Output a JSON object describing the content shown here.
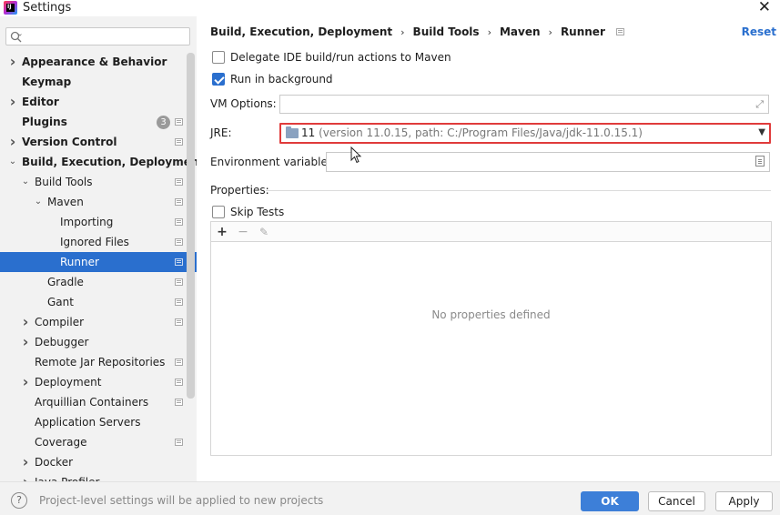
{
  "window": {
    "title": "Settings",
    "close": "✕"
  },
  "search": {
    "placeholder": "",
    "value": ""
  },
  "sidebar": {
    "items": [
      {
        "label": "Appearance & Behavior",
        "level": 0,
        "arrow": "›",
        "bold": true,
        "proj": false
      },
      {
        "label": "Keymap",
        "level": 0,
        "arrow": "",
        "bold": true,
        "proj": false
      },
      {
        "label": "Editor",
        "level": 0,
        "arrow": "›",
        "bold": true,
        "proj": false
      },
      {
        "label": "Plugins",
        "level": 0,
        "arrow": "",
        "bold": true,
        "proj": true,
        "badge": "3"
      },
      {
        "label": "Version Control",
        "level": 0,
        "arrow": "›",
        "bold": true,
        "proj": true
      },
      {
        "label": "Build, Execution, Deployment",
        "level": 0,
        "arrow": "⌄",
        "bold": true,
        "proj": false
      },
      {
        "label": "Build Tools",
        "level": 1,
        "arrow": "⌄",
        "bold": false,
        "proj": true
      },
      {
        "label": "Maven",
        "level": 2,
        "arrow": "⌄",
        "bold": false,
        "proj": true
      },
      {
        "label": "Importing",
        "level": 3,
        "arrow": "",
        "bold": false,
        "proj": true
      },
      {
        "label": "Ignored Files",
        "level": 3,
        "arrow": "",
        "bold": false,
        "proj": true
      },
      {
        "label": "Runner",
        "level": 3,
        "arrow": "",
        "bold": false,
        "proj": true,
        "selected": true
      },
      {
        "label": "Gradle",
        "level": 2,
        "arrow": "",
        "bold": false,
        "proj": true
      },
      {
        "label": "Gant",
        "level": 2,
        "arrow": "",
        "bold": false,
        "proj": true
      },
      {
        "label": "Compiler",
        "level": 1,
        "arrow": "›",
        "bold": false,
        "proj": true
      },
      {
        "label": "Debugger",
        "level": 1,
        "arrow": "›",
        "bold": false,
        "proj": false
      },
      {
        "label": "Remote Jar Repositories",
        "level": 1,
        "arrow": "",
        "bold": false,
        "proj": true
      },
      {
        "label": "Deployment",
        "level": 1,
        "arrow": "›",
        "bold": false,
        "proj": true
      },
      {
        "label": "Arquillian Containers",
        "level": 1,
        "arrow": "",
        "bold": false,
        "proj": true
      },
      {
        "label": "Application Servers",
        "level": 1,
        "arrow": "",
        "bold": false,
        "proj": false
      },
      {
        "label": "Coverage",
        "level": 1,
        "arrow": "",
        "bold": false,
        "proj": true
      },
      {
        "label": "Docker",
        "level": 1,
        "arrow": "›",
        "bold": false,
        "proj": false
      },
      {
        "label": "Java Profiler",
        "level": 1,
        "arrow": "›",
        "bold": false,
        "proj": false
      }
    ]
  },
  "breadcrumb": {
    "items": [
      "Build, Execution, Deployment",
      "Build Tools",
      "Maven",
      "Runner"
    ],
    "sep": "›"
  },
  "reset_label": "Reset",
  "form": {
    "delegate_label": "Delegate IDE build/run actions to Maven",
    "delegate_checked": false,
    "run_bg_label": "Run in background",
    "run_bg_checked": true,
    "vm_options_label": "VM Options:",
    "vm_options_value": "",
    "jre_label": "JRE:",
    "jre_version": "11",
    "jre_detail": "(version 11.0.15, path: C:/Program Files/Java/jdk-11.0.15.1)",
    "env_label": "Environment variables:",
    "env_value": "",
    "properties_label": "Properties:",
    "skip_tests_label": "Skip Tests",
    "skip_tests_checked": false,
    "add": "+",
    "remove": "−",
    "edit": "✎",
    "empty": "No properties defined"
  },
  "footer": {
    "help": "?",
    "note": "Project-level settings will be applied to new projects",
    "ok": "OK",
    "cancel": "Cancel",
    "apply": "Apply"
  },
  "colors": {
    "accent": "#2a6fce",
    "selected_bg": "#2a6fce",
    "error_border": "#e03b3b",
    "primary_btn": "#3d7fd8"
  }
}
